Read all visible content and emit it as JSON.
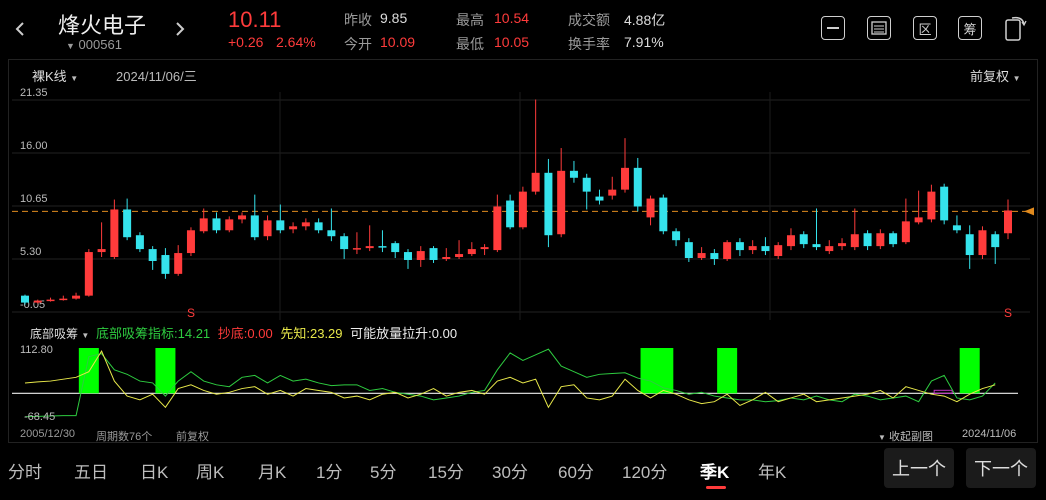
{
  "stock": {
    "name": "烽火电子",
    "code": "000561",
    "price": "10.11",
    "change": "+0.26",
    "change_pct": "2.64%"
  },
  "quote": {
    "prev_close_label": "昨收",
    "prev_close": "9.85",
    "open_label": "今开",
    "open": "10.09",
    "high_label": "最高",
    "high": "10.54",
    "low_label": "最低",
    "low": "10.05",
    "amount_label": "成交额",
    "amount": "4.88亿",
    "turnover_label": "换手率",
    "turnover": "7.91%"
  },
  "toolbar": {
    "icons": [
      "minus-square-icon",
      "calendar-icon",
      "region-icon",
      "chip-icon",
      "rotate-icon"
    ],
    "region_label": "区",
    "chip_label": "筹"
  },
  "kline": {
    "mode_label": "裸K线",
    "date": "2024/11/06/三",
    "adjust_label": "前复权",
    "y_ticks": [
      "21.35",
      "16.00",
      "10.65",
      "5.30",
      "-0.05"
    ],
    "current_line": 10.11,
    "markers": [
      "S",
      "S"
    ]
  },
  "indicator": {
    "name": "底部吸筹",
    "main_label": "底部吸筹指标:",
    "main_value": "14.21",
    "copy_label": "抄底:",
    "copy_value": "0.00",
    "pre_label": "先知:",
    "pre_value": "23.29",
    "vol_label": "可能放量拉升:",
    "vol_value": "0.00",
    "y_top": "112.80",
    "y_bottom": "-68.45"
  },
  "footer": {
    "start_date": "2005/12/30",
    "period_count": "周期数76个",
    "adjust": "前复权",
    "collapse": "收起副图",
    "end_date": "2024/11/06"
  },
  "tabs": [
    "分时",
    "五日",
    "日K",
    "周K",
    "月K",
    "1分",
    "5分",
    "15分",
    "30分",
    "60分",
    "120分",
    "季K",
    "年K"
  ],
  "active_tab": "季K",
  "nav": {
    "prev": "上一个",
    "next": "下一个"
  },
  "colors": {
    "up": "#ff3b3b",
    "down": "#35e3ec",
    "indicator_main": "#2ecc40",
    "indicator_second": "#e8e84a",
    "bar": "#00ff00",
    "current_line": "#e08a1e",
    "active_tab": "#ff3b3b"
  },
  "chart_data": {
    "type": "candlestick",
    "ylim": [
      -0.05,
      21.35
    ],
    "candles": [
      {
        "o": 1.6,
        "c": 0.9,
        "h": 1.7,
        "l": 0.7
      },
      {
        "o": 0.9,
        "c": 1.1,
        "h": 1.2,
        "l": 0.8
      },
      {
        "o": 1.1,
        "c": 1.2,
        "h": 1.4,
        "l": 1.0
      },
      {
        "o": 1.2,
        "c": 1.3,
        "h": 1.6,
        "l": 1.1
      },
      {
        "o": 1.3,
        "c": 1.6,
        "h": 1.9,
        "l": 1.2
      },
      {
        "o": 1.6,
        "c": 6.0,
        "h": 6.3,
        "l": 1.5
      },
      {
        "o": 6.0,
        "c": 6.3,
        "h": 9.0,
        "l": 5.5
      },
      {
        "o": 5.5,
        "c": 10.3,
        "h": 11.3,
        "l": 5.3
      },
      {
        "o": 10.3,
        "c": 7.5,
        "h": 11.4,
        "l": 7.2
      },
      {
        "o": 7.7,
        "c": 6.3,
        "h": 8.0,
        "l": 6.0
      },
      {
        "o": 6.3,
        "c": 5.1,
        "h": 6.6,
        "l": 4.2
      },
      {
        "o": 5.7,
        "c": 3.8,
        "h": 6.4,
        "l": 3.3
      },
      {
        "o": 3.8,
        "c": 5.9,
        "h": 6.7,
        "l": 3.6
      },
      {
        "o": 5.9,
        "c": 8.2,
        "h": 8.5,
        "l": 5.6
      },
      {
        "o": 8.1,
        "c": 9.4,
        "h": 10.4,
        "l": 7.9
      },
      {
        "o": 9.4,
        "c": 8.2,
        "h": 10.0,
        "l": 7.9
      },
      {
        "o": 8.2,
        "c": 9.3,
        "h": 9.6,
        "l": 8.0
      },
      {
        "o": 9.3,
        "c": 9.7,
        "h": 10.0,
        "l": 8.9
      },
      {
        "o": 9.7,
        "c": 7.5,
        "h": 11.8,
        "l": 7.2
      },
      {
        "o": 7.6,
        "c": 9.2,
        "h": 9.7,
        "l": 7.2
      },
      {
        "o": 9.2,
        "c": 8.2,
        "h": 10.8,
        "l": 7.9
      },
      {
        "o": 8.3,
        "c": 8.6,
        "h": 9.0,
        "l": 7.9
      },
      {
        "o": 8.6,
        "c": 9.0,
        "h": 9.4,
        "l": 8.2
      },
      {
        "o": 9.0,
        "c": 8.2,
        "h": 9.4,
        "l": 7.9
      },
      {
        "o": 8.2,
        "c": 7.6,
        "h": 10.4,
        "l": 7.1
      },
      {
        "o": 7.6,
        "c": 6.3,
        "h": 7.9,
        "l": 5.3
      },
      {
        "o": 6.3,
        "c": 6.4,
        "h": 8.0,
        "l": 5.8
      },
      {
        "o": 6.4,
        "c": 6.6,
        "h": 8.7,
        "l": 6.1
      },
      {
        "o": 6.6,
        "c": 6.5,
        "h": 8.2,
        "l": 6.0
      },
      {
        "o": 6.9,
        "c": 6.0,
        "h": 7.1,
        "l": 5.4
      },
      {
        "o": 6.0,
        "c": 5.2,
        "h": 6.3,
        "l": 4.3
      },
      {
        "o": 5.2,
        "c": 6.1,
        "h": 6.6,
        "l": 4.5
      },
      {
        "o": 6.4,
        "c": 5.2,
        "h": 6.6,
        "l": 4.9
      },
      {
        "o": 5.3,
        "c": 5.5,
        "h": 6.4,
        "l": 5.1
      },
      {
        "o": 5.5,
        "c": 5.8,
        "h": 7.2,
        "l": 5.3
      },
      {
        "o": 5.8,
        "c": 6.3,
        "h": 7.0,
        "l": 5.6
      },
      {
        "o": 6.3,
        "c": 6.5,
        "h": 6.8,
        "l": 5.7
      },
      {
        "o": 6.2,
        "c": 10.6,
        "h": 11.8,
        "l": 6.0
      },
      {
        "o": 11.2,
        "c": 8.5,
        "h": 11.8,
        "l": 8.3
      },
      {
        "o": 8.5,
        "c": 12.1,
        "h": 12.6,
        "l": 8.3
      },
      {
        "o": 12.1,
        "c": 14.0,
        "h": 21.4,
        "l": 11.8
      },
      {
        "o": 14.0,
        "c": 7.7,
        "h": 15.4,
        "l": 6.5
      },
      {
        "o": 7.8,
        "c": 14.2,
        "h": 16.5,
        "l": 7.5
      },
      {
        "o": 14.2,
        "c": 13.5,
        "h": 15.2,
        "l": 13.0
      },
      {
        "o": 13.5,
        "c": 12.1,
        "h": 13.9,
        "l": 10.3
      },
      {
        "o": 11.6,
        "c": 11.2,
        "h": 12.3,
        "l": 10.8
      },
      {
        "o": 11.7,
        "c": 12.3,
        "h": 13.6,
        "l": 11.3
      },
      {
        "o": 12.3,
        "c": 14.5,
        "h": 17.5,
        "l": 12.0
      },
      {
        "o": 14.5,
        "c": 10.6,
        "h": 15.5,
        "l": 10.1
      },
      {
        "o": 9.5,
        "c": 11.4,
        "h": 11.7,
        "l": 8.7
      },
      {
        "o": 11.5,
        "c": 8.1,
        "h": 11.8,
        "l": 7.8
      },
      {
        "o": 8.1,
        "c": 7.2,
        "h": 8.4,
        "l": 6.6
      },
      {
        "o": 7.0,
        "c": 5.4,
        "h": 7.4,
        "l": 5.0
      },
      {
        "o": 5.4,
        "c": 5.9,
        "h": 6.5,
        "l": 5.2
      },
      {
        "o": 5.9,
        "c": 5.3,
        "h": 6.3,
        "l": 4.7
      },
      {
        "o": 5.3,
        "c": 7.0,
        "h": 7.2,
        "l": 5.1
      },
      {
        "o": 7.0,
        "c": 6.2,
        "h": 7.4,
        "l": 5.6
      },
      {
        "o": 6.2,
        "c": 6.6,
        "h": 7.2,
        "l": 5.8
      },
      {
        "o": 6.6,
        "c": 6.1,
        "h": 7.5,
        "l": 5.7
      },
      {
        "o": 5.6,
        "c": 6.7,
        "h": 7.0,
        "l": 5.3
      },
      {
        "o": 6.6,
        "c": 7.7,
        "h": 8.4,
        "l": 6.2
      },
      {
        "o": 7.8,
        "c": 6.8,
        "h": 8.1,
        "l": 6.4
      },
      {
        "o": 6.8,
        "c": 6.5,
        "h": 10.4,
        "l": 6.2
      },
      {
        "o": 6.1,
        "c": 6.6,
        "h": 7.2,
        "l": 5.8
      },
      {
        "o": 6.6,
        "c": 6.9,
        "h": 7.4,
        "l": 6.2
      },
      {
        "o": 6.5,
        "c": 7.8,
        "h": 10.4,
        "l": 6.2
      },
      {
        "o": 7.9,
        "c": 6.6,
        "h": 8.2,
        "l": 6.2
      },
      {
        "o": 6.6,
        "c": 7.9,
        "h": 8.3,
        "l": 6.3
      },
      {
        "o": 7.9,
        "c": 6.8,
        "h": 8.1,
        "l": 6.5
      },
      {
        "o": 7.0,
        "c": 9.1,
        "h": 11.4,
        "l": 6.8
      },
      {
        "o": 9.0,
        "c": 9.5,
        "h": 12.2,
        "l": 8.8
      },
      {
        "o": 9.3,
        "c": 12.1,
        "h": 12.8,
        "l": 9.0
      },
      {
        "o": 12.6,
        "c": 9.2,
        "h": 12.9,
        "l": 8.8
      },
      {
        "o": 8.7,
        "c": 8.2,
        "h": 9.7,
        "l": 7.9
      },
      {
        "o": 7.8,
        "c": 5.7,
        "h": 8.7,
        "l": 4.3
      },
      {
        "o": 5.7,
        "c": 8.2,
        "h": 8.6,
        "l": 5.3
      },
      {
        "o": 7.8,
        "c": 6.5,
        "h": 8.1,
        "l": 4.8
      },
      {
        "o": 7.9,
        "c": 10.2,
        "h": 11.3,
        "l": 7.3
      }
    ],
    "indicator_bars": [
      5,
      11,
      49,
      50,
      55,
      74
    ],
    "series": [
      {
        "name": "底部吸筹指标",
        "values": [
          -65,
          -64,
          -63,
          -62,
          -62,
          95,
          103,
          60,
          48,
          30,
          25,
          -10,
          30,
          55,
          30,
          20,
          15,
          40,
          45,
          25,
          45,
          30,
          35,
          25,
          18,
          20,
          20,
          5,
          10,
          0,
          -5,
          -10,
          -20,
          -15,
          -10,
          0,
          5,
          60,
          105,
          85,
          100,
          115,
          70,
          55,
          40,
          48,
          50,
          52,
          38,
          30,
          12,
          5,
          -5,
          0,
          -10,
          -15,
          -20,
          -20,
          -25,
          -22,
          -15,
          -20,
          -10,
          -20,
          -25,
          -5,
          -10,
          -20,
          -15,
          -10,
          -25,
          30,
          45,
          -15,
          -20,
          -10,
          25
        ]
      },
      {
        "name": "先知",
        "values": [
          25,
          28,
          30,
          35,
          40,
          55,
          110,
          30,
          -10,
          -20,
          -5,
          -40,
          10,
          20,
          5,
          -5,
          0,
          10,
          15,
          -5,
          5,
          -10,
          10,
          5,
          0,
          -15,
          -10,
          -20,
          -5,
          0,
          -15,
          -5,
          10,
          -10,
          0,
          5,
          -5,
          30,
          40,
          25,
          35,
          -40,
          15,
          20,
          -15,
          -20,
          -10,
          35,
          5,
          -15,
          5,
          -5,
          -20,
          -30,
          -25,
          -5,
          -35,
          -20,
          0,
          -25,
          -15,
          -5,
          -25,
          -20,
          -15,
          -10,
          -5,
          5,
          -15,
          15,
          5,
          -5,
          -10,
          -25,
          -5,
          10,
          20
        ]
      }
    ]
  }
}
